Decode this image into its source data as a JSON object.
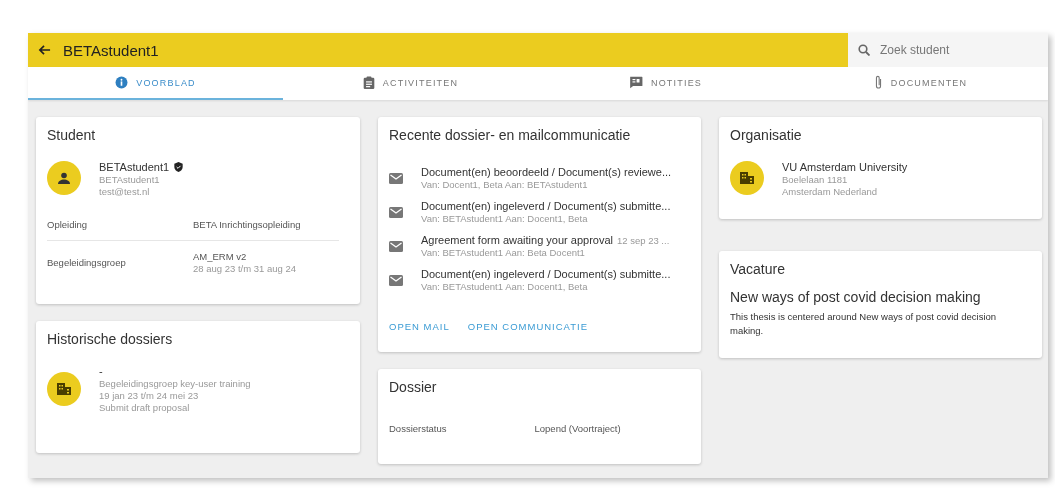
{
  "header": {
    "title": "BETAstudent1",
    "search": {
      "placeholder": "Zoek student"
    }
  },
  "tabs": [
    {
      "label": "VOORBLAD",
      "kind": "info",
      "selected": true
    },
    {
      "label": "ACTIVITEITEN",
      "kind": "clipboard",
      "selected": false
    },
    {
      "label": "NOTITIES",
      "kind": "note",
      "selected": false
    },
    {
      "label": "DOCUMENTEN",
      "kind": "clip",
      "selected": false
    }
  ],
  "student": {
    "title": "Student",
    "name": "BETAstudent1",
    "username": "BETAstudent1",
    "email": "test@test.nl",
    "rows": [
      {
        "label": "Opleiding",
        "value": "BETA Inrichtingsopleiding"
      },
      {
        "label": "Begeleidingsgroep",
        "value": "AM_ERM v2",
        "sub": "28 aug 23 t/m 31 aug 24"
      }
    ]
  },
  "history": {
    "title": "Historische dossiers",
    "items": [
      {
        "title": "-",
        "lines": [
          "Begeleidingsgroep key-user training",
          "19 jan 23 t/m 24 mei 23",
          "Submit draft proposal"
        ]
      }
    ]
  },
  "communication": {
    "title": "Recente dossier- en mailcommunicatie",
    "items": [
      {
        "subject": "Document(en) beoordeeld / Document(s) reviewe...",
        "from_to": "Van: Docent1, Beta Aan: BETAstudent1"
      },
      {
        "subject": "Document(en) ingeleverd / Document(s) submitte...",
        "from_to": "Van: BETAstudent1 Aan: Docent1, Beta"
      },
      {
        "subject": "Agreement form awaiting your approval",
        "date": "12 sep 23 ...",
        "from_to": "Van: BETAstudent1 Aan: Beta Docent1"
      },
      {
        "subject": "Document(en) ingeleverd / Document(s) submitte...",
        "from_to": "Van: BETAstudent1 Aan: Docent1, Beta"
      }
    ],
    "actions": [
      "OPEN MAIL",
      "OPEN COMMUNICATIE"
    ]
  },
  "dossier": {
    "title": "Dossier",
    "rows": [
      {
        "label": "Dossierstatus",
        "value": "Lopend (Voortraject)"
      }
    ]
  },
  "organisation": {
    "title": "Organisatie",
    "name": "VU Amsterdam University",
    "lines": [
      "Boelelaan 1181",
      "Amsterdam Nederland"
    ]
  },
  "vacancy": {
    "title": "Vacature",
    "heading": "New ways of post covid decision making",
    "description": "This thesis is centered around New ways of post covid decision making."
  }
}
